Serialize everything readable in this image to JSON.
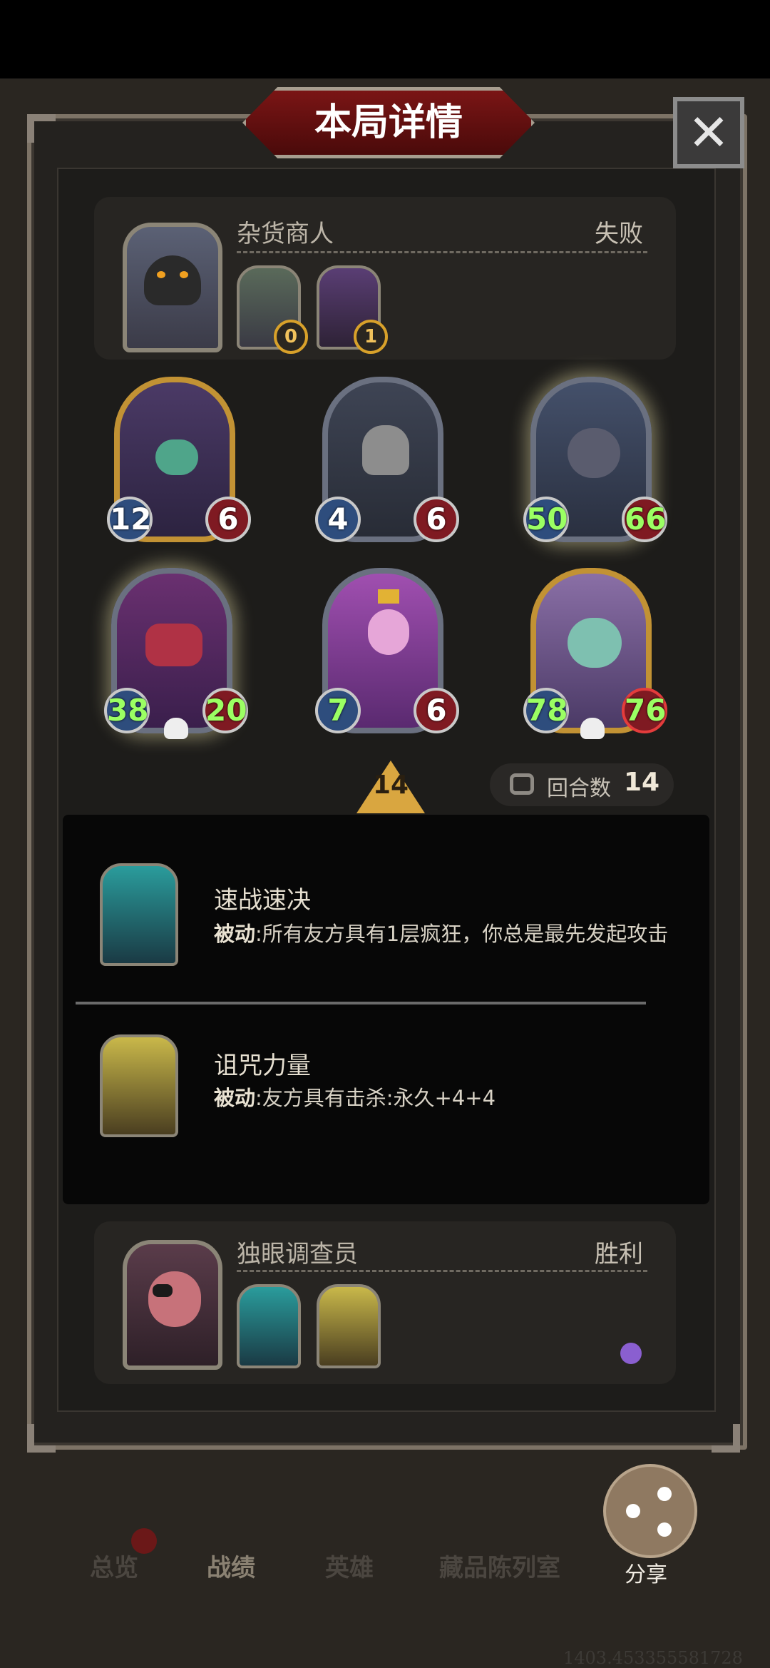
{
  "title": "本局详情",
  "close_glyph": "✕",
  "opponent": {
    "name": "杂货商人",
    "result": "失败",
    "items": [
      {
        "count": "0"
      },
      {
        "count": "1"
      }
    ]
  },
  "board": [
    {
      "atk": "12",
      "hp": "6",
      "atk_green": false,
      "hp_green": false
    },
    {
      "atk": "4",
      "hp": "6",
      "atk_green": false,
      "hp_green": false
    },
    {
      "atk": "50",
      "hp": "66",
      "atk_green": true,
      "hp_green": true
    },
    {
      "atk": "38",
      "hp": "20",
      "atk_green": true,
      "hp_green": true
    },
    {
      "atk": "7",
      "hp": "6",
      "atk_green": true,
      "hp_green": false
    },
    {
      "atk": "78",
      "hp": "76",
      "atk_green": true,
      "hp_green": true
    }
  ],
  "level": "14",
  "rounds": {
    "label": "回合数",
    "value": "14"
  },
  "skills": [
    {
      "name": "速战速决",
      "tag": "被动",
      "desc": ":所有友方具有1层疯狂，你总是最先发起攻击"
    },
    {
      "name": "诅咒力量",
      "tag": "被动",
      "desc": ":友方具有击杀:永久+4+4"
    }
  ],
  "player": {
    "name": "独眼调查员",
    "result": "胜利"
  },
  "nav": {
    "overview": "总览",
    "record": "战绩",
    "hero": "英雄",
    "collection": "藏品陈列室",
    "share": "分享"
  },
  "footer_number": "1403.453355581728",
  "colors": {
    "accent_gold": "#d8a12a",
    "title_red": "#7a1515",
    "green_stat": "#9bff63"
  }
}
